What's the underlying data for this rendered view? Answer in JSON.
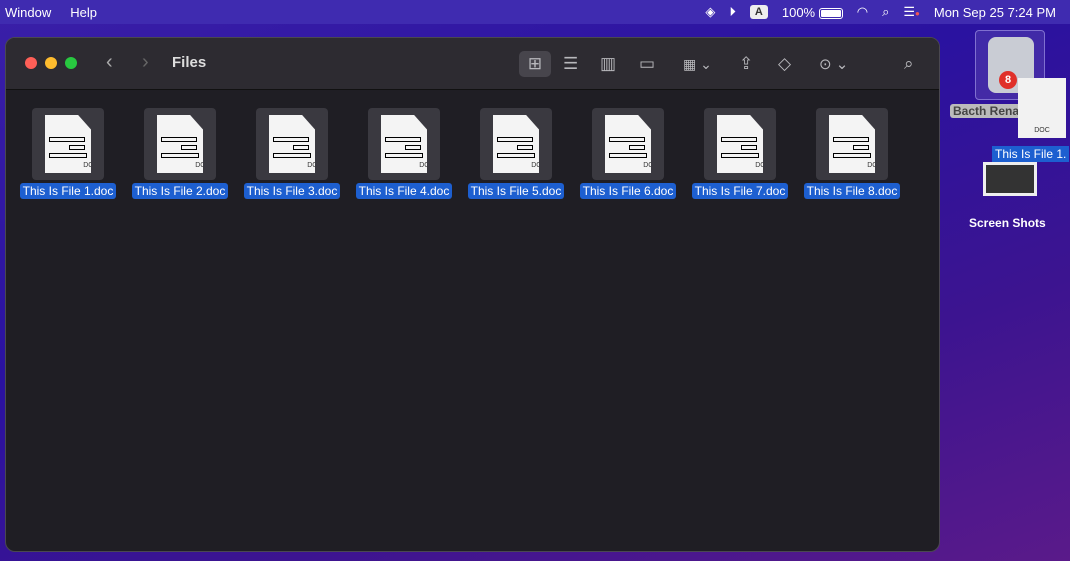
{
  "menubar": {
    "menus": [
      "Window",
      "Help"
    ],
    "input_source": "A",
    "battery": "100%",
    "clock": "Mon Sep 25  7:24 PM"
  },
  "window": {
    "title": "Files"
  },
  "files": [
    "This Is File 1.doc",
    "This Is File 2.doc",
    "This Is File 3.doc",
    "This Is File 4.doc",
    "This Is File 5.doc",
    "This Is File 6.doc",
    "This Is File 7.doc",
    "This Is File 8.doc"
  ],
  "doc_icon_label": "DOC",
  "desktop": {
    "app_label": "Bacth Rena",
    "badge": "8",
    "drag_label": "This Is File 1.",
    "folder_label": "Screen Shots"
  }
}
